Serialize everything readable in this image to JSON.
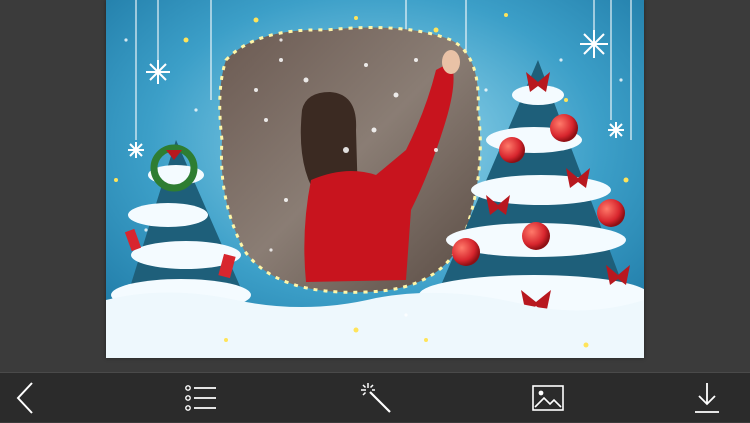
{
  "app": {
    "screen": "photo-frame-editor"
  },
  "frame": {
    "theme": "christmas-snow",
    "colors": {
      "sky": "#4fb3d6",
      "snow": "#f4fbff",
      "tree": "#1e5f7a",
      "ornament": "#d8262e",
      "bow": "#b8181f"
    }
  },
  "toolbar": {
    "background": "#2b2b2b",
    "icon_color": "#ffffff",
    "items": [
      {
        "id": "back",
        "icon": "chevron-left-icon"
      },
      {
        "id": "list",
        "icon": "list-icon"
      },
      {
        "id": "effects",
        "icon": "magic-wand-icon"
      },
      {
        "id": "gallery",
        "icon": "image-icon"
      },
      {
        "id": "download",
        "icon": "download-icon"
      }
    ]
  }
}
